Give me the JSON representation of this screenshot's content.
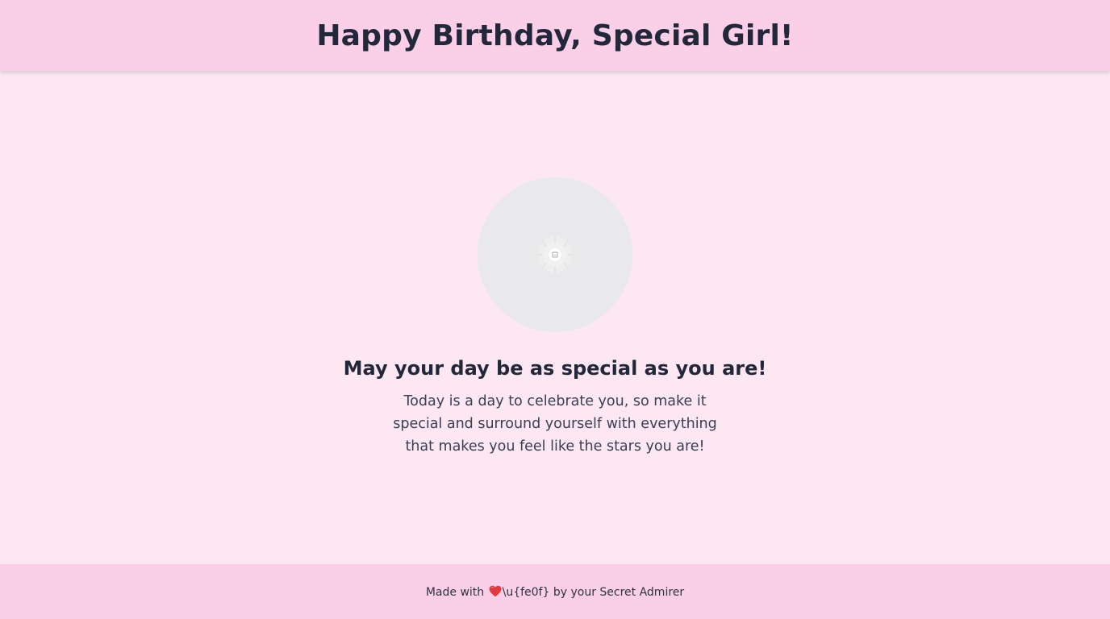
{
  "header": {
    "title": "Happy Birthday, Special Girl!"
  },
  "photo": {
    "icon": "image-loading-icon"
  },
  "message": {
    "title": "May your day be as special as you are!",
    "body": "Today is a day to celebrate you, so make it special and surround yourself with everything that makes you feel like the stars you are!"
  },
  "footer": {
    "prefix": "Made with ",
    "heart_icon": "red-heart-icon",
    "after_heart": "\\u{fe0f} by your Secret Admirer"
  },
  "colors": {
    "page_background": "#fce7f3",
    "bar_background": "#fbcfe8",
    "heading_text": "#22273a",
    "heart": "#e0393e"
  }
}
